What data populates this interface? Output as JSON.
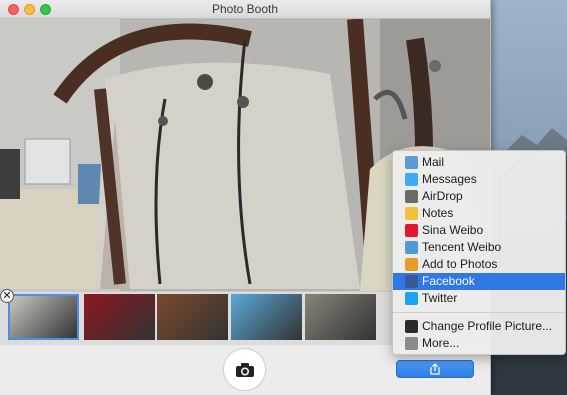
{
  "window": {
    "title": "Photo Booth"
  },
  "thumbnails": [
    {
      "name": "thumb-bag",
      "color": "#c9c7c2",
      "selected": true
    },
    {
      "name": "thumb-red",
      "color": "#8c1820",
      "selected": false
    },
    {
      "name": "thumb-brown",
      "color": "#7a4a2b",
      "selected": false
    },
    {
      "name": "thumb-blue",
      "color": "#5aa8d8",
      "selected": false
    },
    {
      "name": "thumb-hand",
      "color": "#8a8478",
      "selected": false
    }
  ],
  "share_menu": {
    "items": [
      {
        "label": "Mail",
        "icon": "mail-icon",
        "color": "#5b9bd5"
      },
      {
        "label": "Messages",
        "icon": "messages-icon",
        "color": "#3fa9f5"
      },
      {
        "label": "AirDrop",
        "icon": "airdrop-icon",
        "color": "#6a6a6a"
      },
      {
        "label": "Notes",
        "icon": "notes-icon",
        "color": "#f0c23b"
      },
      {
        "label": "Sina Weibo",
        "icon": "sina-weibo-icon",
        "color": "#e6162d"
      },
      {
        "label": "Tencent Weibo",
        "icon": "tencent-weibo-icon",
        "color": "#4f9ad6"
      },
      {
        "label": "Add to Photos",
        "icon": "photos-icon",
        "color": "#e89b2c"
      },
      {
        "label": "Facebook",
        "icon": "facebook-icon",
        "color": "#3b5998",
        "highlighted": true
      },
      {
        "label": "Twitter",
        "icon": "twitter-icon",
        "color": "#1da1f2"
      }
    ],
    "extra_items": [
      {
        "label": "Change Profile Picture...",
        "icon": "person-icon",
        "color": "#2b2b2b"
      },
      {
        "label": "More...",
        "icon": "more-icon",
        "color": "#8a8a8a"
      }
    ]
  },
  "colors": {
    "accent": "#2f78e5"
  }
}
